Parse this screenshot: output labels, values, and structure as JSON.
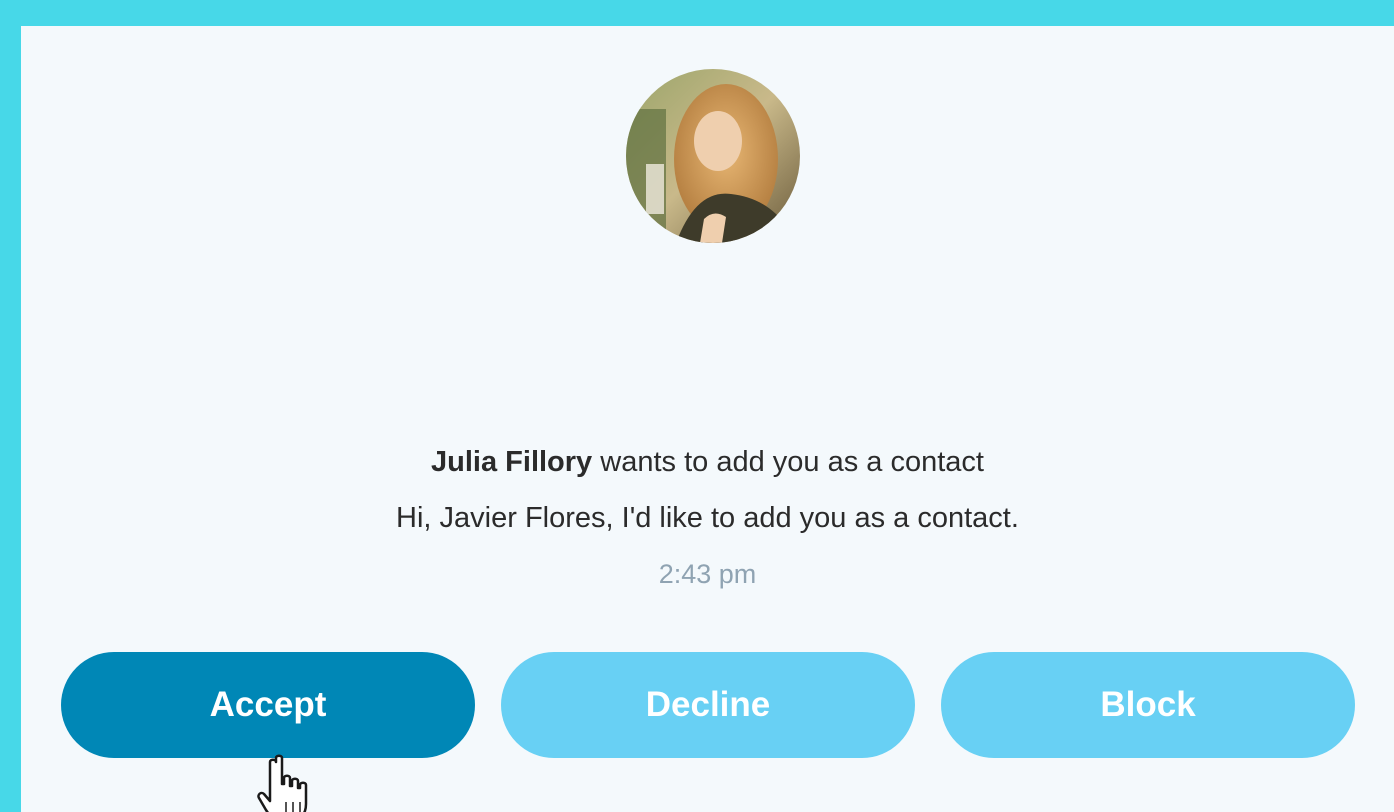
{
  "request": {
    "name": "Julia Fillory",
    "message_suffix": " wants to add you as a contact",
    "greeting": "Hi, Javier Flores, I'd like to add you as a contact.",
    "time": "2:43 pm"
  },
  "buttons": {
    "accept": "Accept",
    "decline": "Decline",
    "block": "Block"
  },
  "colors": {
    "frame": "#47d8e8",
    "accept": "#0087b6",
    "secondary": "#68d0f4"
  },
  "icons": {
    "cursor": "hand-pointer-icon"
  }
}
